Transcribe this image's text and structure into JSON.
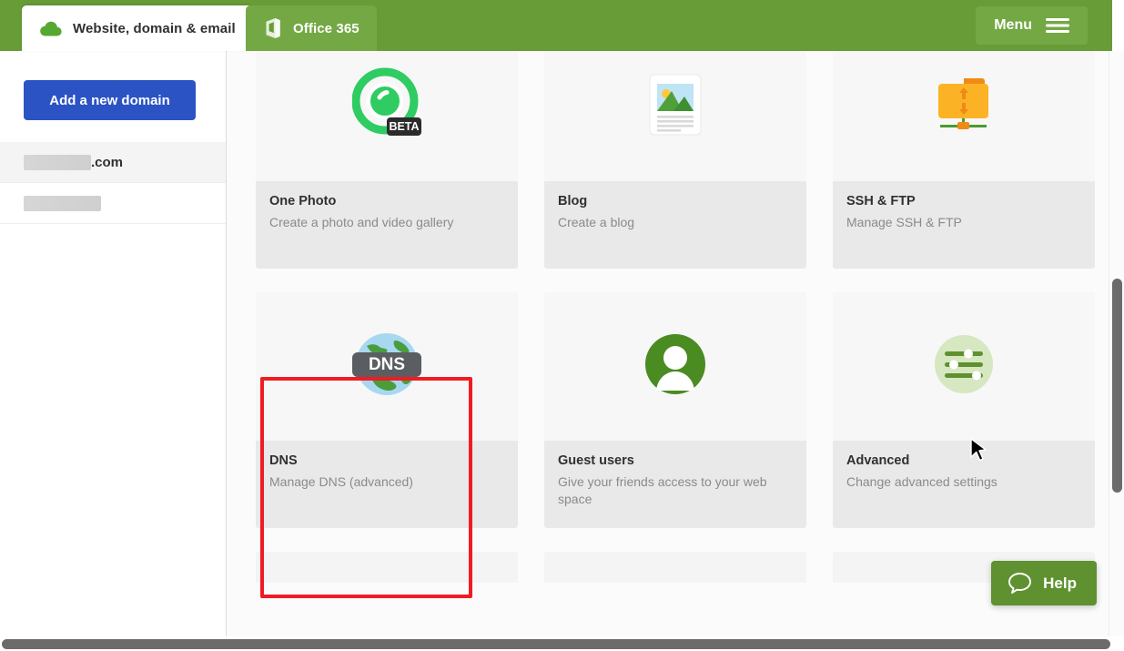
{
  "header": {
    "background_color": "#679c36",
    "tabs": [
      {
        "label": "Website, domain & email",
        "icon": "cloud-icon",
        "active": true
      },
      {
        "label": "Office 365",
        "icon": "office-365-icon",
        "active": false
      }
    ],
    "menu_button": {
      "label": "Menu",
      "icon": "hamburger-icon"
    }
  },
  "sidebar": {
    "add_domain_label": "Add a new domain",
    "add_domain_color": "#2b53c4",
    "domains": [
      {
        "label": ".com",
        "redacted": true,
        "selected": true
      },
      {
        "label": "",
        "redacted": true,
        "selected": false
      }
    ]
  },
  "main": {
    "cards": [
      {
        "title": "One Photo",
        "description": "Create a photo and video gallery",
        "icon": "one-photo-icon",
        "badge": "BETA",
        "highlighted": false
      },
      {
        "title": "Blog",
        "description": "Create a blog",
        "icon": "blog-icon",
        "badge": "",
        "highlighted": false
      },
      {
        "title": "SSH & FTP",
        "description": "Manage SSH & FTP",
        "icon": "ssh-ftp-icon",
        "badge": "",
        "highlighted": false
      },
      {
        "title": "DNS",
        "description": "Manage DNS (advanced)",
        "icon": "dns-globe-icon",
        "badge": "",
        "highlighted": true
      },
      {
        "title": "Guest users",
        "description": "Give your friends access to your web space",
        "icon": "guest-users-icon",
        "badge": "",
        "highlighted": false
      },
      {
        "title": "Advanced",
        "description": "Change advanced settings",
        "icon": "advanced-settings-icon",
        "badge": "",
        "highlighted": false
      }
    ]
  },
  "help_widget": {
    "label": "Help",
    "icon": "speech-bubble-icon",
    "color": "#5f9130"
  },
  "annotation": {
    "color": "#ee1d23",
    "target": "DNS"
  }
}
